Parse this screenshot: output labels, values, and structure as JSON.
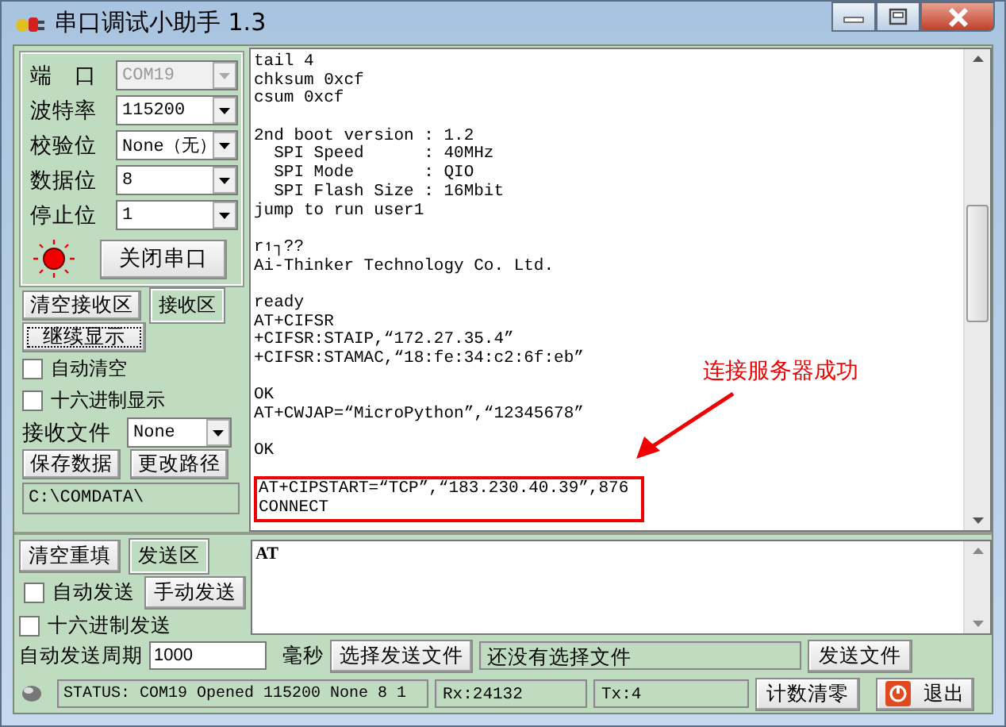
{
  "window": {
    "title": "串口调试小助手 1.3"
  },
  "serial_settings": [
    {
      "label": "端　口",
      "value": "COM19",
      "disabled": true
    },
    {
      "label": "波特率",
      "value": "115200",
      "disabled": false
    },
    {
      "label": "校验位",
      "value": "None（无）",
      "disabled": false
    },
    {
      "label": "数据位",
      "value": "8",
      "disabled": false
    },
    {
      "label": "停止位",
      "value": "1",
      "disabled": false
    }
  ],
  "port_indicator": {
    "on": true
  },
  "open_close_button": "关闭串口",
  "receive_controls": {
    "clear_button": "清空接收区",
    "area_label": "接收区",
    "continue_button": "继续显示",
    "checkboxes": [
      {
        "label": "自动清空",
        "checked": false
      },
      {
        "label": "十六进制显示",
        "checked": false
      }
    ],
    "file_label": "接收文件",
    "file_value": "None",
    "save_button": "保存数据",
    "change_path_button": "更改路径",
    "path": "C:\\COMDATA\\"
  },
  "receive_log": {
    "paragraphs": [
      [
        "tail 4",
        "chksum 0xcf",
        "csum 0xcf"
      ],
      [
        "2nd boot version : 1.2",
        "  SPI Speed      : 40MHz",
        "  SPI Mode       : QIO",
        "  SPI Flash Size : 16Mbit",
        "jump to run user1"
      ],
      [
        "r↿┐??",
        "Ai-Thinker Technology Co. Ltd."
      ],
      [
        "ready",
        "AT+CIFSR",
        "+CIFSR:STAIP,“172.27.35.4”",
        "+CIFSR:STAMAC,“18:fe:34:c2:6f:eb”"
      ],
      [
        "OK",
        "AT+CWJAP=“MicroPython”,“12345678”"
      ],
      [
        "OK"
      ]
    ],
    "highlighted": [
      "AT+CIPSTART=“TCP”,“183.230.40.39”,876",
      "CONNECT"
    ]
  },
  "annotation": {
    "text": "连接服务器成功"
  },
  "send_controls": {
    "clear_button": "清空重填",
    "area_label": "发送区",
    "checkboxes": [
      {
        "label": "自动发送",
        "checked": false
      },
      {
        "label": "十六进制发送",
        "checked": false
      }
    ],
    "manual_send_button": "手动发送",
    "send_text": "AT",
    "period_label": "自动发送周期",
    "period_value": "1000",
    "ms_label": "毫秒",
    "choose_file_button": "选择发送文件",
    "file_status": "还没有选择文件",
    "send_file_button": "发送文件"
  },
  "status_bar": {
    "status": "STATUS:  COM19 Opened 115200 None  8 1",
    "rx": "Rx:24132",
    "tx": "Tx:4",
    "reset_button": "计数清零",
    "exit_button": "退出"
  }
}
